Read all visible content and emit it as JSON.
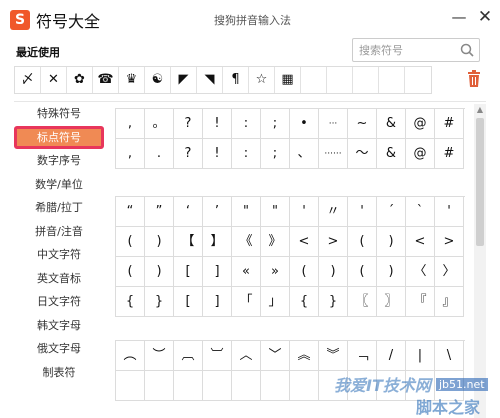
{
  "title_bar": {
    "logo_glyph": "S",
    "app_title": "符号大全",
    "ime_name": "搜狗拼音输入法",
    "minimize": "—",
    "close": "✕"
  },
  "recent": {
    "label": "最近使用",
    "symbols": [
      "〆",
      "✕",
      "✿",
      "☎",
      "♛",
      "☯",
      "◤",
      "◥",
      "¶",
      "☆",
      "▦",
      "",
      "",
      "",
      "",
      ""
    ]
  },
  "search": {
    "placeholder": "搜索符号",
    "value": ""
  },
  "nav": {
    "items": [
      "特殊符号",
      "标点符号",
      "数字序号",
      "数学/单位",
      "希腊/拉丁",
      "拼音/注音",
      "中文字符",
      "英文音标",
      "日文字符",
      "韩文字母",
      "俄文字母",
      "制表符"
    ],
    "active_index": 1
  },
  "grid": {
    "block1": [
      [
        ",",
        "。",
        "?",
        "!",
        ":",
        ";",
        "•",
        "···",
        "~",
        "&",
        "@",
        "#"
      ],
      [
        ",",
        ".",
        "?",
        "!",
        ":",
        ";",
        "、",
        "······",
        "～",
        "&",
        "@",
        "#"
      ]
    ],
    "block2": [
      [
        "“",
        "”",
        "‘",
        "’",
        "\"",
        "\"",
        "'",
        "〃",
        "'",
        "ˊ",
        "ˋ",
        "'"
      ],
      [
        "(",
        ")",
        "【",
        "】",
        "《",
        "》",
        "<",
        ">",
        "(",
        ")",
        "<",
        ">"
      ],
      [
        "(",
        ")",
        "[",
        "]",
        "«",
        "»",
        "(",
        ")",
        "(",
        ")",
        "〈",
        "〉"
      ],
      [
        "{",
        "}",
        "[",
        "]",
        "「",
        "」",
        "{",
        "}",
        "〖",
        "〗",
        "『",
        "』"
      ]
    ],
    "block3": [
      [
        "︵",
        "︶",
        "︹",
        "︺",
        "︿",
        "﹀",
        "︽",
        "︾",
        "﹁",
        "/",
        "|",
        "\\"
      ],
      [
        "",
        "",
        "",
        "",
        "",
        "",
        "",
        "",
        "",
        "",
        "",
        ""
      ]
    ]
  },
  "watermark": {
    "text": "我爱IT技术网",
    "url": "jb51.net",
    "text2": "脚本之家"
  },
  "colors": {
    "accent": "#f08a54",
    "highlight_border": "#e8365b",
    "brand": "#f0582a"
  }
}
